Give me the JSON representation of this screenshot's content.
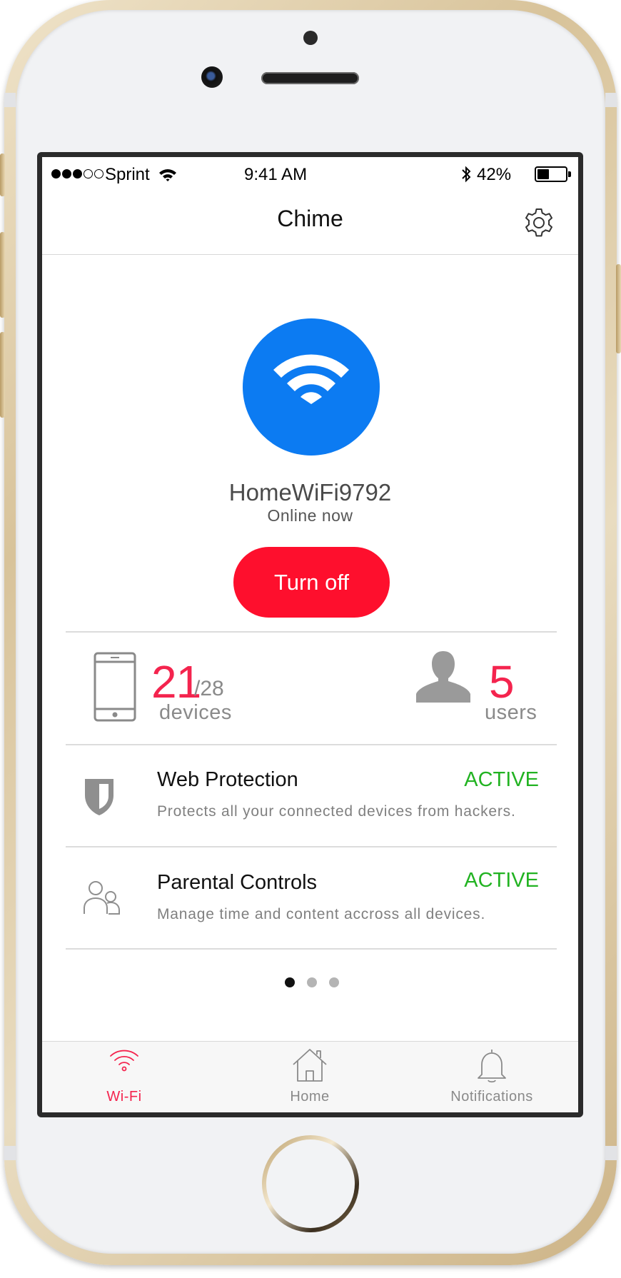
{
  "status_bar": {
    "carrier": "Sprint",
    "time": "9:41 AM",
    "battery_percent": "42%",
    "battery_level": 0.42,
    "signal_bars_filled": 3,
    "signal_bars_total": 5
  },
  "nav": {
    "title": "Chime",
    "settings_icon": "gear-icon"
  },
  "network": {
    "name": "HomeWiFi9792",
    "status": "Online now",
    "icon": "wifi-icon",
    "icon_color": "#0c7bf2"
  },
  "actions": {
    "turn_off_label": "Turn off",
    "turn_off_color": "#fe0f2d"
  },
  "stats": {
    "devices_count": "21",
    "devices_total": "/28",
    "devices_label": "devices",
    "users_count": "5",
    "users_label": "users",
    "accent_color": "#f4244e"
  },
  "features": [
    {
      "icon": "shield-icon",
      "title": "Web Protection",
      "description": "Protects all your connected devices from hackers.",
      "status": "ACTIVE"
    },
    {
      "icon": "people-icon",
      "title": "Parental Controls",
      "description": "Manage time and content accross all devices.",
      "status": "ACTIVE"
    }
  ],
  "status_active_color": "#22b322",
  "pagination": {
    "pages": 3,
    "current": 1
  },
  "tabs": [
    {
      "label": "Wi-Fi",
      "icon": "wifi-icon",
      "active": true
    },
    {
      "label": "Home",
      "icon": "house-icon",
      "active": false
    },
    {
      "label": "Notifications",
      "icon": "bell-icon",
      "active": false
    }
  ]
}
